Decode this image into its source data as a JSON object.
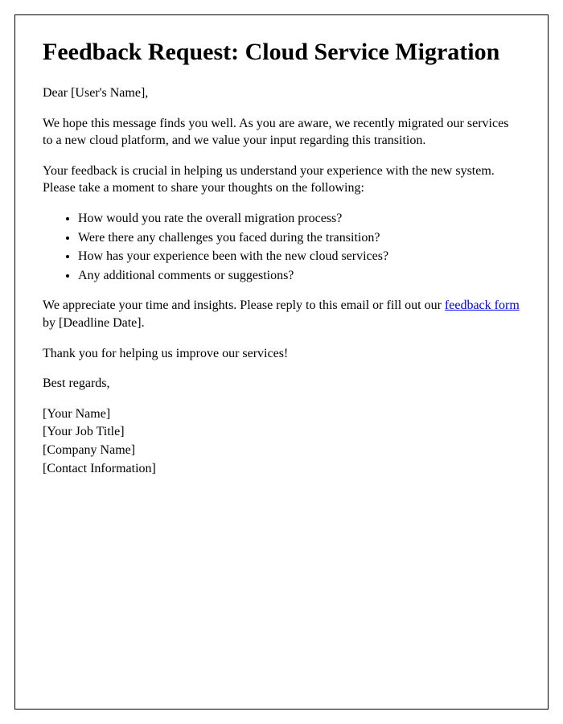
{
  "title": "Feedback Request: Cloud Service Migration",
  "greeting": "Dear [User's Name],",
  "paragraph1": "We hope this message finds you well. As you are aware, we recently migrated our services to a new cloud platform, and we value your input regarding this transition.",
  "paragraph2": "Your feedback is crucial in helping us understand your experience with the new system. Please take a moment to share your thoughts on the following:",
  "questions": [
    "How would you rate the overall migration process?",
    "Were there any challenges you faced during the transition?",
    "How has your experience been with the new cloud services?",
    "Any additional comments or suggestions?"
  ],
  "closing_prefix": "We appreciate your time and insights. Please reply to this email or fill out our ",
  "link_text": "feedback form",
  "closing_suffix": " by [Deadline Date].",
  "thankyou": "Thank you for helping us improve our services!",
  "signoff": "Best regards,",
  "signature": {
    "name": "[Your Name]",
    "title": "[Your Job Title]",
    "company": "[Company Name]",
    "contact": "[Contact Information]"
  }
}
